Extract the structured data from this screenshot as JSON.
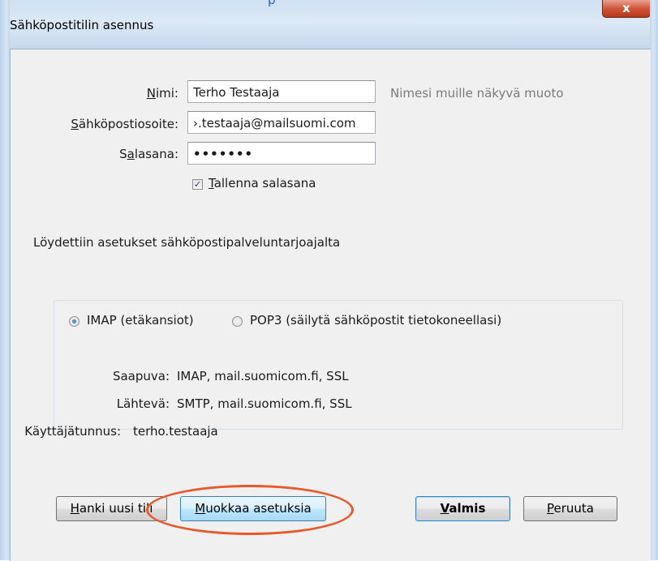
{
  "window": {
    "title": "Sähköpostitilin asennus",
    "title_fragment": "p",
    "close_glyph": "x"
  },
  "form": {
    "name": {
      "label_pre": "",
      "label_key": "N",
      "label_post": "imi:",
      "value": "Terho Testaaja",
      "hint": "Nimesi muille näkyvä muoto"
    },
    "email": {
      "label_pre": "",
      "label_key": "S",
      "label_post": "ähköpostiosoite:",
      "value": "›.testaaja@mailsuomi.com"
    },
    "password": {
      "label_pre": "S",
      "label_key": "a",
      "label_post": "lasana:",
      "value": "•••••••"
    },
    "remember": {
      "checked": true,
      "check_glyph": "✓",
      "label_key": "T",
      "label_post": "allenna salasana"
    }
  },
  "status_text": "Löydettiin asetukset sähköpostipalveluntarjoajalta",
  "protocol": {
    "imap_label": "IMAP (etäkansiot)",
    "pop3_label": "POP3 (säilytä sähköpostit tietokoneellasi)",
    "selected": "IMAP"
  },
  "details": [
    {
      "label": "Saapuva:",
      "value": "IMAP, mail.suomicom.fi, SSL"
    },
    {
      "label": "Lähtevä:",
      "value": "SMTP, mail.suomicom.fi, SSL"
    },
    {
      "label": "Käyttäjätunnus:",
      "value": "terho.testaaja"
    }
  ],
  "buttons": {
    "new_account": {
      "key": "H",
      "rest": "anki uusi tili"
    },
    "edit_settings": {
      "key": "M",
      "rest": "uokkaa asetuksia"
    },
    "done": {
      "key": "V",
      "rest": "almis"
    },
    "cancel": {
      "key": "P",
      "rest": "eruuta"
    }
  },
  "colors": {
    "highlight_ellipse": "#e8582a",
    "close_button": "#c8462a",
    "accent_blue": "#3c7fb1"
  }
}
